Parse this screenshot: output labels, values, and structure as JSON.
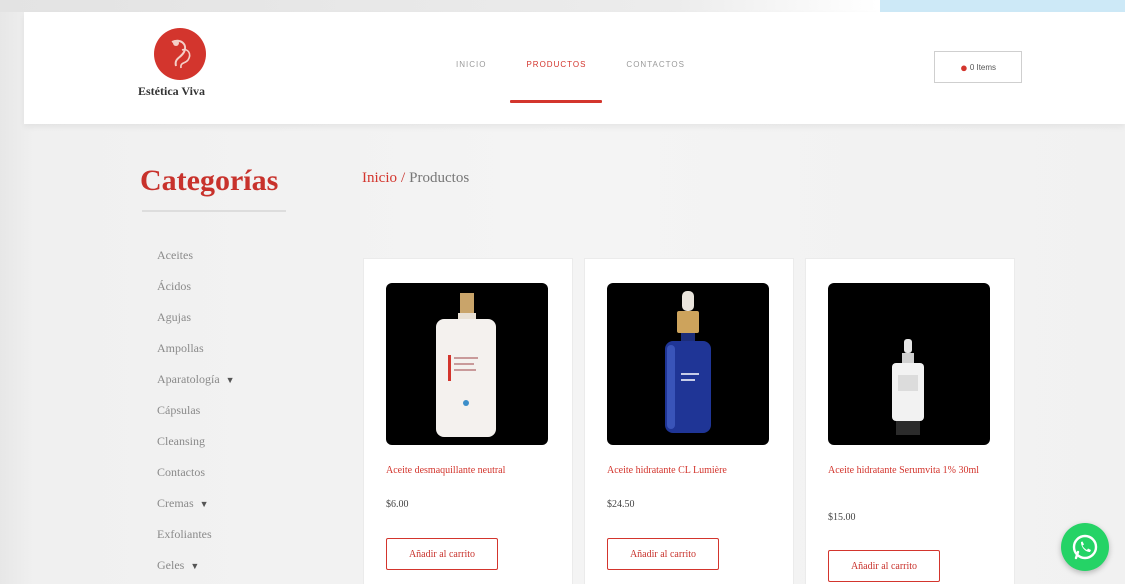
{
  "brand": {
    "name": "Estética Viva"
  },
  "nav": {
    "items": [
      {
        "label": "INICIO",
        "active": false
      },
      {
        "label": "PRODUCTOS",
        "active": true
      },
      {
        "label": "CONTACTOS",
        "active": false
      }
    ]
  },
  "cart": {
    "label": "0 Items",
    "icon": "cart-icon"
  },
  "sidebar": {
    "title": "Categorías",
    "items": [
      {
        "label": "Aceites"
      },
      {
        "label": "Ácidos"
      },
      {
        "label": "Agujas"
      },
      {
        "label": "Ampollas"
      },
      {
        "label": "Aparatología",
        "has_submenu": true
      },
      {
        "label": "Cápsulas"
      },
      {
        "label": "Cleansing"
      },
      {
        "label": "Contactos"
      },
      {
        "label": "Cremas",
        "has_submenu": true
      },
      {
        "label": "Exfoliantes"
      },
      {
        "label": "Geles",
        "has_submenu": true
      }
    ]
  },
  "breadcrumb": {
    "home": "Inicio",
    "separator": "/",
    "current": "Productos"
  },
  "products": [
    {
      "name": "Aceite desmaquillante neutral",
      "price": "$6.00",
      "button": "Añadir al carrito"
    },
    {
      "name": "Aceite hidratante CL Lumière",
      "price": "$24.50",
      "button": "Añadir al carrito"
    },
    {
      "name": "Aceite hidratante Serumvita 1% 30ml",
      "price": "$15.00",
      "button": "Añadir al carrito"
    }
  ],
  "colors": {
    "accent": "#d3352d",
    "whatsapp": "#25d366"
  },
  "floating": {
    "icon": "whatsapp-icon"
  }
}
